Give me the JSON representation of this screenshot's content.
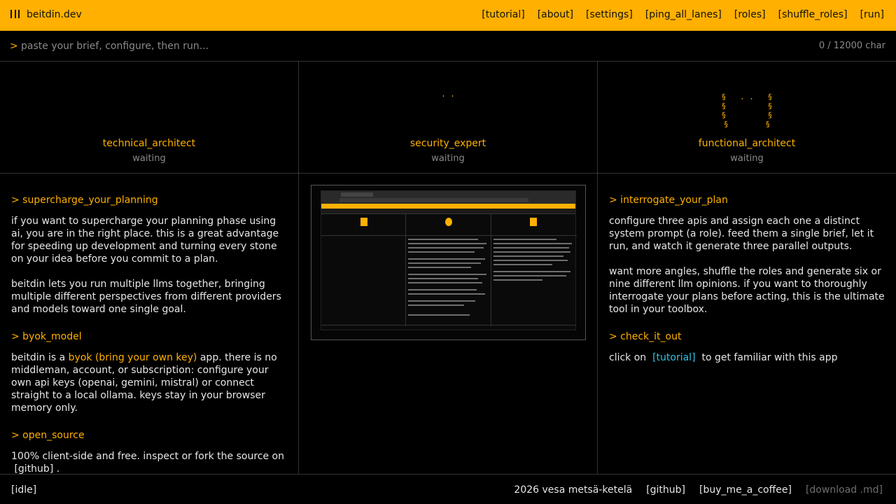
{
  "header": {
    "brand": "beitdin.dev",
    "nav": [
      "[tutorial]",
      "[about]",
      "[settings]",
      "[ping_all_lanes]",
      "[roles]",
      "[shuffle_roles]",
      "[run]"
    ]
  },
  "prompt": {
    "caret": ">",
    "placeholder": "paste your brief, configure, then run...",
    "counter": "0 / 12000 char"
  },
  "lanes": [
    {
      "role": "technical_architect",
      "status": "waiting",
      "art": ""
    },
    {
      "role": "security_expert",
      "status": "waiting",
      "art": ". ."
    },
    {
      "role": "functional_architect",
      "status": "waiting",
      "art": "§   . .   §\n§         §\n§         §\n§        §"
    }
  ],
  "left": {
    "h1": "> supercharge_your_planning",
    "p1": "if you want to supercharge your planning phase using ai, you are in the right place. this is a great advantage for speeding up development and turning every stone on your idea before you commit to a plan.",
    "p2": "beitdin lets you run multiple llms together, bringing multiple different perspectives from different providers and models toward one single goal.",
    "h2": "> byok_model",
    "p3a": "beitdin is a ",
    "p3hl": "byok (bring your own key)",
    "p3b": " app. there is no middleman, account, or subscription: configure your own api keys (openai, gemini, mistral) or connect straight to a local ollama. keys stay in your browser memory only.",
    "h3": "> open_source",
    "p4a": "100% client-side and free. inspect or fork the source on",
    "p4link": "[github]",
    "p4b": "."
  },
  "right": {
    "h1": "> interrogate_your_plan",
    "p1": "configure three apis and assign each one a distinct system prompt (a role). feed them a single brief, let it run, and watch it generate three parallel outputs.",
    "p2": "want more angles, shuffle the roles and generate six or nine different llm opinions. if you want to thoroughly interrogate your plans before acting, this is the ultimate tool in your toolbox.",
    "h2": "> check_it_out",
    "p3a": "click on",
    "p3link": "[tutorial]",
    "p3b": "to get familiar with this app"
  },
  "footer": {
    "status": "[idle]",
    "credit": "2026 vesa metsä-ketelä",
    "github": "[github]",
    "coffee": "[buy_me_a_coffee]",
    "download": "[download .md]"
  },
  "colors": {
    "accent": "#ffb000",
    "link": "#2ec4e6",
    "muted": "#8a8a8a"
  }
}
